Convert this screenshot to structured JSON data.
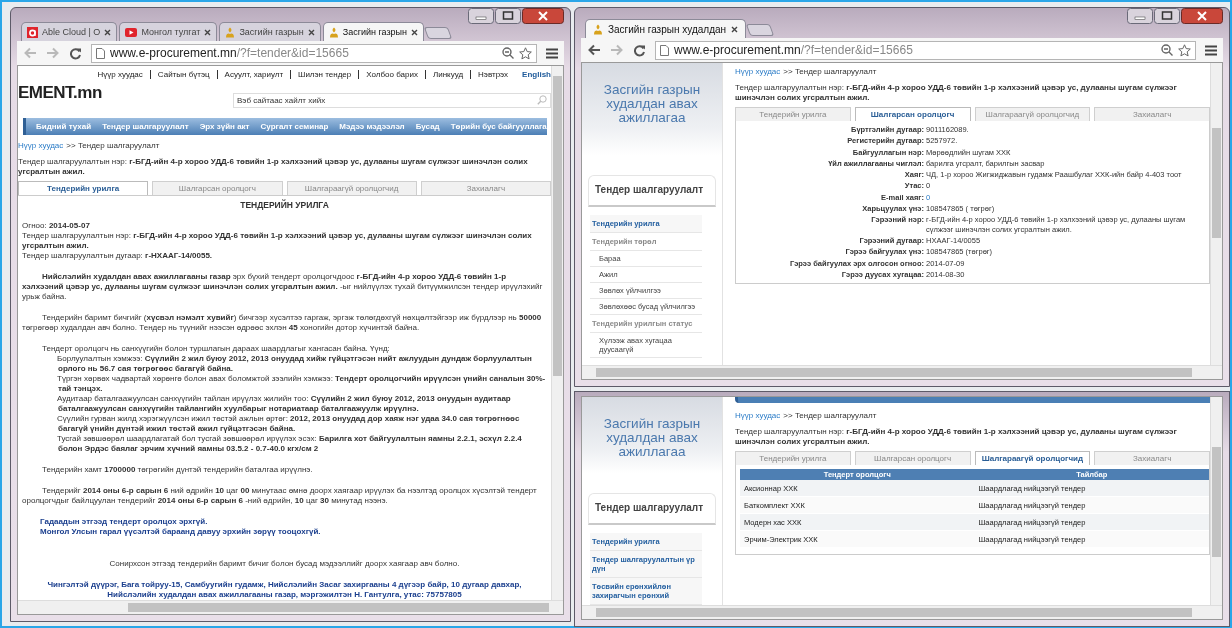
{
  "left_window": {
    "tabs": [
      {
        "kind": "able",
        "title": "Able Cloud | О",
        "selected": false
      },
      {
        "kind": "video",
        "title": "Монгол тулгат",
        "selected": false
      },
      {
        "kind": "emblem",
        "title": "Засгийн газрын",
        "selected": false
      },
      {
        "kind": "emblem",
        "title": "Засгийн газрын",
        "selected": true
      }
    ],
    "address": {
      "host": "www.e-procurement.mn",
      "path": "/?f=tender&id=15665"
    },
    "page": {
      "top_links": [
        "Нүүр хуудас",
        "Сайтын бүтэц",
        "Асуулт, хариулт",
        "Шилэн тендер",
        "Холбоо барих",
        "Линкууд",
        "Нэвтрэх",
        "English"
      ],
      "logo": "EMENT.mn",
      "search": {
        "placeholder": "Вэб сайтаас хайлт хийх"
      },
      "nav": [
        "Бидний тухай",
        "Тендер шалгаруулалт",
        "Эрх зүйн акт",
        "Сургалт семинар",
        "Мэдээ мэдээлэл",
        "Бусад",
        "Төрийн бус байгууллага"
      ],
      "breadcrumb": {
        "home": "Нүүр хуудас",
        "separator": ">>",
        "current": "Тендер шалгаруулалт"
      },
      "tender_name": "Тендер шалгаруулалтын нэр: **г-БГД-ийн 4-р хороо УДД-6 төвийн 1-р хэлхээний цэвэр ус, дулааны шугам сүлжээг шинэчлэн солих угсралтын ажил.**",
      "content_tabs": [
        {
          "label": "Тендерийн урилга",
          "selected": true
        },
        {
          "label": "Шалгарсан оролцогч",
          "selected": false
        },
        {
          "label": "Шалгараагүй оролцогчид",
          "selected": false
        },
        {
          "label": "Захиалагч",
          "selected": false
        }
      ],
      "heading": "ТЕНДЕРИЙН УРИЛГА",
      "body": [
        {
          "kind": "line",
          "text": "Огноо: **2014-05-07**"
        },
        {
          "kind": "line",
          "text": "Тендер шалгаруулалтын нэр: **г-БГД-ийн 4-р хороо УДД-6 төвийн 1-р хэлхээний цэвэр ус, дулааны шугам сүлжээг шинэчлэн солих угсралтын ажил.**"
        },
        {
          "kind": "line",
          "text": "Тендер шалгаруулалтын дугаар: **г-НХААГ-14/0055.**"
        },
        {
          "kind": "para",
          "text": "**Нийслэлийн худалдан авах ажиллагааны газар** эрх бүхий тендерт оролцогчдоос **г-БГД-ийн 4-р хороо УДД-6 төвийн 1-р хэлхээний цэвэр ус, дулааны шугам сүлжээг шинэчлэн солих угсралтын ажил.** -ыг нийлүүлэх тухай битүүмжилсэн тендер ирүүлэхийг урьж байна."
        },
        {
          "kind": "para",
          "text": "Тендерийн баримт бичгийг (**хүсвэл нэмэлт хувийг**) бичгээр хүсэлтээ гаргаж, эргэж төлөгдөхгүй нөхцөлтэйгээр иж бүрдлээр нь **50000** төгрөгөөр худалдан авч болно. Тендер нь түүнийг нээсэн өдрөөс эхлэн **45** хоногийн дотор хүчинтэй байна."
        },
        {
          "kind": "intro",
          "text": "Тендерт оролцогч нь санхүүгийн болон туршлагын дараах шаардлагыг хангасан байна. Үүнд:"
        },
        {
          "kind": "sub",
          "text": "Борлуулалтын хэмжээ: **Сүүлийн 2 жил буюу 2012, 2013 онуудад хийж гүйцэтгэсэн нийт ажлуудын дундаж борлуулалтын орлого нь 56.7 сая төгрөгөөс багагүй байна.**"
        },
        {
          "kind": "sub",
          "text": "Түргэн хөрвөх чадвартай хөрөнгө болон авах боломжтой зээлийн хэмжээ: **Тендерт оролцогчийн ирүүлсэн үнийн саналын 30%-тай тэнцэх.**"
        },
        {
          "kind": "sub",
          "text": "Аудитаар баталгаажуулсан санхүүгийн тайлан ирүүлэх жилийн тоо: **Сүүлийн 2 жил буюу 2012, 2013 онуудын аудитаар баталгаажуулсан санхүүгийн тайлангийн хуулбарыг нотариатаар баталгаажуулж ирүүлнэ.**"
        },
        {
          "kind": "sub",
          "text": "Сүүлийн гурван жилд хэрэгжүүлсэн ижил төстэй ажлын өртөг: **2012, 2013 онуудад дор хаяж нэг удаа 34.0 сая төгрөгнөөс багагүй үнийн дүнтэй ижил төстэй ажил гүйцэтгэсэн байна.**"
        },
        {
          "kind": "sub",
          "text": "Тусгай зөвшөөрөл шаардлагатай бол тусгай зөвшөөрөл ирүүлэх эсэх: **Барилга хот байгуулалтын яамны 2.2.1, эсхүл 2.2.4 болон Эрдэс баялаг эрчим хүчний яамны 03.5.2 - 0.7-40.0 кгх/см 2**"
        },
        {
          "kind": "para",
          "text": "Тендерийн хамт **1700000** төгрөгийн дүнтэй тендерийн баталгаа ирүүлнэ."
        },
        {
          "kind": "para",
          "text": "Тендерийг **2014 оны 6-р сарын 6** ний өдрийн **10** цаг **00** минутаас өмнө доорх хаягаар ирүүлэх ба нээлтэд оролцох хүсэлтэй тендерт оролцогчдыг байлцуулан тендерийг **2014 оны 6-р сарын 6** -ний өдрийн, **10** цаг **30** минутад нээнэ."
        },
        {
          "kind": "notice",
          "text": "Гадаадын этгээд тендерт оролцох эрхгүй."
        },
        {
          "kind": "notice",
          "text": "Монгол Улсын гарал үүсэлтэй бараанд давуу эрхийн зөрүү тооцохгүй."
        },
        {
          "kind": "center",
          "text": "Сонирхсон этгээд тендерийн баримт бичиг болон бусад мэдээллийг доорх хаягаар авч болно."
        },
        {
          "kind": "address",
          "text": "Чингэлтэй дүүрэг, Бага тойруу-15, Самбуугийн гудамж, Нийслэлийн Засаг захиргааны 4 дүгээр байр, 10 дугаар давхар, Нийслэлийн худалдан авах ажиллагааны газар, мэргэжилтэн Н. Гантулга, утас: 75757805"
        }
      ]
    }
  },
  "right_top_window": {
    "tabs": [
      {
        "kind": "emblem",
        "title": "Засгийн газрын худалдан",
        "selected": true
      }
    ],
    "address": {
      "host": "www.e-procurement.mn",
      "path": "/?f=tender&id=15665"
    },
    "sidebar": {
      "banner": "Засгийн газрын худалдан авах ажиллагаа",
      "title": "Тендер шалгаруулалт",
      "items": [
        {
          "kind": "link",
          "label": "Тендерийн урилга"
        },
        {
          "kind": "group",
          "label": "Тендерийн төрөл"
        },
        {
          "kind": "sub",
          "label": "Бараа"
        },
        {
          "kind": "sub",
          "label": "Ажил"
        },
        {
          "kind": "sub",
          "label": "Зөвлөх үйлчилгээ"
        },
        {
          "kind": "sub",
          "label": "Зөвлөхөөс бусад үйлчилгээ"
        },
        {
          "kind": "group",
          "label": "Тендерийн урилгын статус"
        },
        {
          "kind": "sub",
          "label": "Хүлээж авах хугацаа дуусаагүй"
        }
      ]
    },
    "page": {
      "breadcrumb": {
        "home": "Нүүр хуудас",
        "separator": ">>",
        "current": "Тендер шалгаруулалт"
      },
      "tender_name": "Тендер шалгаруулалтын нэр: **г-БГД-ийн 4-р хороо УДД-6 төвийн 1-р хэлхээний цэвэр ус, дулааны шугам сүлжээг шинэчлэн солих угсралтын ажил.**",
      "content_tabs": [
        {
          "label": "Тендерийн урилга",
          "selected": false
        },
        {
          "label": "Шалгарсан оролцогч",
          "selected": true
        },
        {
          "label": "Шалгараагүй оролцогчид",
          "selected": false
        },
        {
          "label": "Захиалагч",
          "selected": false
        }
      ],
      "details": [
        {
          "label": "Бүртгэлийн дугаар:",
          "value": "9011162089.",
          "kind": "text"
        },
        {
          "label": "Регистерийн дугаар:",
          "value": "5257972.",
          "kind": "text"
        },
        {
          "label": "Байгууллагын нэр:",
          "value": "Мөрөөдлийн шугам ХХК",
          "kind": "text"
        },
        {
          "label": "Үйл ажиллагааны чиглэл:",
          "value": "барилга угсралт, барилгын засвар",
          "kind": "text"
        },
        {
          "label": "Хаяг:",
          "value": "ЧД, 1-р хороо Жигжиджавын гудамж Раашбулаг ХХК-ийн байр 4-403 тоот",
          "kind": "text"
        },
        {
          "label": "Утас:",
          "value": "0",
          "kind": "text"
        },
        {
          "label": "E-mail хаяг:",
          "value": "0",
          "kind": "link"
        },
        {
          "label": "Харьцуулах үнэ:",
          "value": "108547865 ( төгрөг)",
          "kind": "text"
        },
        {
          "label": "Гэрээний нэр:",
          "value": "г-БГД-ийн 4-р хороо УДД-6 төвийн 1-р хэлхээний цэвэр ус, дулааны шугам сүлжээг шинэчлэн солих угсралтын ажил.",
          "kind": "text"
        },
        {
          "label": "Гэрээний дугаар:",
          "value": "НХААГ-14/0055",
          "kind": "text"
        },
        {
          "label": "Гэрээ байгуулах үнэ:",
          "value": "108547865 (төгрөг)",
          "kind": "text"
        },
        {
          "label": "Гэрээ байгуулах эрх олгосон огноо:",
          "value": "2014-07-09",
          "kind": "text"
        },
        {
          "label": "Гэрээ дуусах хугацаа:",
          "value": "2014-08-30",
          "kind": "text"
        }
      ]
    }
  },
  "right_bottom_window": {
    "sidebar": {
      "banner": "Засгийн газрын худалдан авах ажиллагаа",
      "title": "Тендер шалгаруулалт",
      "items": [
        {
          "kind": "link",
          "label": "Тендерийн урилга"
        },
        {
          "kind": "link",
          "label": "Тендер шалгаруулалтын үр дүн"
        },
        {
          "kind": "link",
          "label": "Төсвийн ерөнхийлөн захирагчын ерөнхий"
        }
      ]
    },
    "page": {
      "breadcrumb": {
        "home": "Нүүр хуудас",
        "separator": ">>",
        "current": "Тендер шалгаруулалт"
      },
      "tender_name": "Тендер шалгаруулалтын нэр: **г-БГД-ийн 4-р хороо УДД-6 төвийн 1-р хэлхээний цэвэр ус, дулааны шугам сүлжээг шинэчлэн солих угсралтын ажил.**",
      "content_tabs": [
        {
          "label": "Тендерийн урилга",
          "selected": false
        },
        {
          "label": "Шалгарсан оролцогч",
          "selected": false
        },
        {
          "label": "Шалгараагүй оролцогчид",
          "selected": true
        },
        {
          "label": "Захиалагч",
          "selected": false
        }
      ],
      "table": {
        "columns": [
          "Тендерт оролцогч",
          "Тайлбар"
        ],
        "rows": [
          [
            "Аксионнар ХХК",
            "Шаардлагад нийцээгүй тендер"
          ],
          [
            "Баткомплект ХХК",
            "Шаардлагад нийцээгүй тендер"
          ],
          [
            "Модерн хас ХХК",
            "Шаардлагад нийцээгүй тендер"
          ],
          [
            "Эрчим-Электрик ХХК",
            "Шаардлагад нийцээгүй тендер"
          ]
        ]
      }
    }
  }
}
